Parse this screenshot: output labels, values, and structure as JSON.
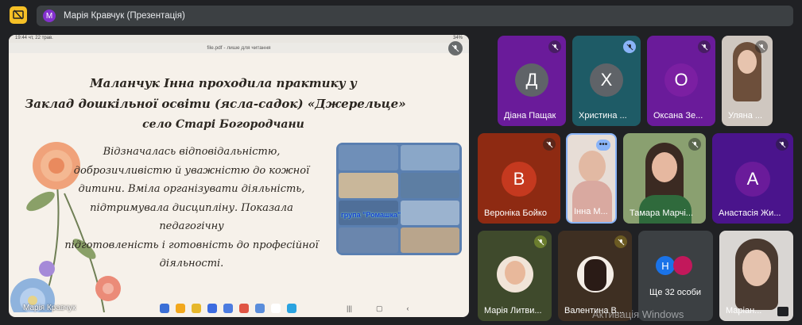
{
  "header": {
    "presenter_initial": "М",
    "presentation_title": "Марія Кравчук (Презентація)"
  },
  "presentation": {
    "status_time": "19:44",
    "status_date": "чт, 22 трав.",
    "status_battery": "34%",
    "pdf_title": "file.pdf - лише для читання",
    "heading_line1": "Маланчук Інна проходила практику у",
    "heading_line2": "Заклад дошкільної освіти (ясла-садок) «Джерельце»",
    "heading_line3": "село Старі Богородчани",
    "body_lines": [
      "Відзначалась відповідальністю,",
      "доброзичливістю й уважністю до кожної",
      "дитини. Вміла організувати діяльність,",
      "підтримувала дисципліну. Показала педагогічну",
      "підготовленість і готовність до професійної",
      "діяльності."
    ],
    "photo_label": "група \"Ромашка\"",
    "presenter_name": "Марія Кравчук"
  },
  "participants": [
    {
      "name": "Діана Пащак",
      "initial": "Д",
      "bg": "#6a1b9a",
      "avatar": "#5f6368"
    },
    {
      "name": "Христина ...",
      "initial": "Х",
      "bg": "#1e5b66",
      "avatar": "#5f6368"
    },
    {
      "name": "Оксана Зе...",
      "initial": "О",
      "bg": "#6a1b9a",
      "avatar": "#7b1fa2"
    },
    {
      "name": "Уляна ...",
      "initial": "",
      "bg": "#cfc7c0",
      "avatar": ""
    },
    {
      "name": "Вероніка Бойко",
      "initial": "В",
      "bg": "#8e2a12",
      "avatar": "#c5391f"
    },
    {
      "name": "Інна М...",
      "initial": "",
      "bg": "#e7ddd6",
      "avatar": ""
    },
    {
      "name": "Тамара Марчі...",
      "initial": "",
      "bg": "#8aa070",
      "avatar": ""
    },
    {
      "name": "Анастасія Жи...",
      "initial": "А",
      "bg": "#4a148c",
      "avatar": "#6a1b9a"
    },
    {
      "name": "Марія Литви...",
      "initial": "",
      "bg": "#3f4a2c",
      "avatar": ""
    },
    {
      "name": "Валентина В...",
      "initial": "",
      "bg": "#3e2f22",
      "avatar": ""
    },
    {
      "name": "Ще 32 особи",
      "initial": "Н",
      "bg": "#3c4043",
      "avatar": "#1a73e8"
    },
    {
      "name": "Маріан...",
      "initial": "",
      "bg": "#d9d6d3",
      "avatar": ""
    }
  ],
  "watermark": "Активація Windows",
  "colors": {
    "background": "#202124",
    "tile_purple": "#6a1b9a",
    "meet_accent": "#f6c026"
  }
}
